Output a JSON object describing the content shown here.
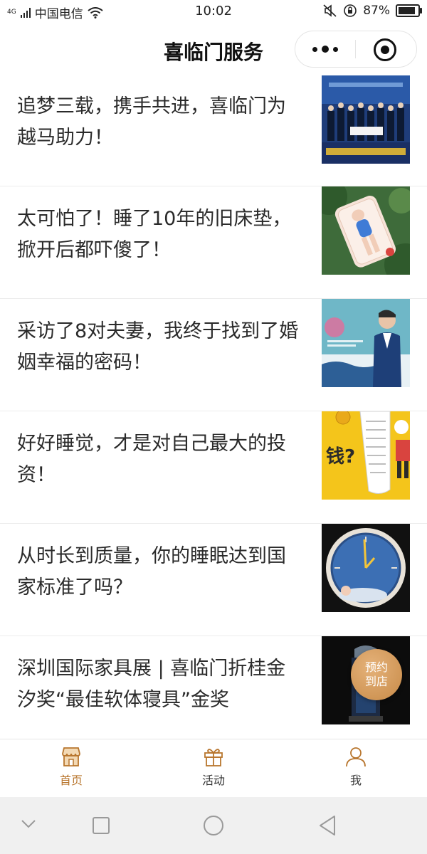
{
  "status": {
    "network": "4G",
    "carrier": "中国电信",
    "time": "10:02",
    "battery_percent": "87%",
    "battery_level": 0.87
  },
  "nav": {
    "title": "喜临门服务"
  },
  "articles": [
    {
      "title": "追梦三载，携手共进，喜临门为越马助力！",
      "thumb": "event-photo"
    },
    {
      "title": "太可怕了！睡了10年的旧床垫，掀开后都吓傻了！",
      "thumb": "mattress-illustration"
    },
    {
      "title": "采访了8对夫妻，我终于找到了婚姻幸福的密码！",
      "thumb": "couple-poster"
    },
    {
      "title": "好好睡觉，才是对自己最大的投资！",
      "thumb": "money-illustration"
    },
    {
      "title": "从时长到质量，你的睡眠达到国家标准了吗？",
      "thumb": "clock-sleep-illustration"
    },
    {
      "title": "深圳国际家具展 | 喜临门折桂金汐奖“最佳软体寝具”金奖",
      "thumb": "award-trophy"
    }
  ],
  "reserve_button": {
    "line1": "预约",
    "line2": "到店"
  },
  "tabbar": {
    "home": "首页",
    "activity": "活动",
    "me": "我",
    "active_color": "#b8762e",
    "inactive_color": "#333333"
  }
}
